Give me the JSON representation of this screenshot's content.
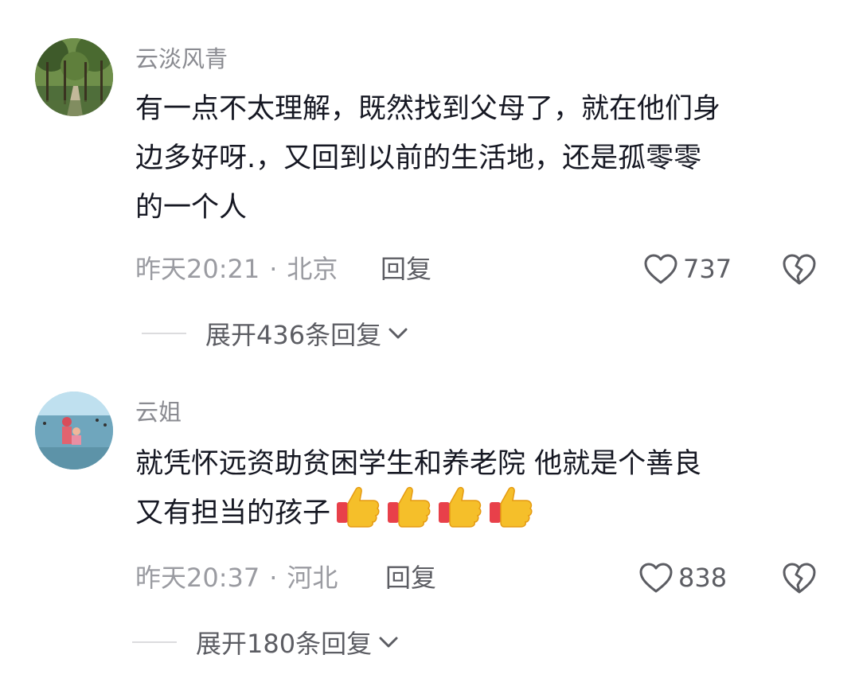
{
  "comments": [
    {
      "username": "云淡风青",
      "lines": [
        "有一点不太理解，既然找到父母了，就在他们身",
        "边多好呀.，又回到以前的生活地，还是孤零零",
        "的一个人"
      ],
      "time": "昨天20:21",
      "location": "北京",
      "reply_label": "回复",
      "likes": "737",
      "expand_label": "展开436条回复"
    },
    {
      "username": "云姐",
      "lines": [
        "就凭怀远资助贫困学生和养老院 他就是个善良",
        "又有担当的孩子"
      ],
      "emoji_count": 4,
      "time": "昨天20:37",
      "location": "河北",
      "reply_label": "回复",
      "likes": "838",
      "expand_label": "展开180条回复"
    }
  ],
  "separator": "·",
  "icons": {
    "like": "heart-outline-icon",
    "dislike": "broken-heart-icon",
    "expand": "chevron-down-icon",
    "emoji": "thumbs-up-emoji"
  },
  "colors": {
    "username": "#8a8b91",
    "text": "#161823",
    "meta": "#9a9ba1",
    "action": "#5c5d63"
  }
}
